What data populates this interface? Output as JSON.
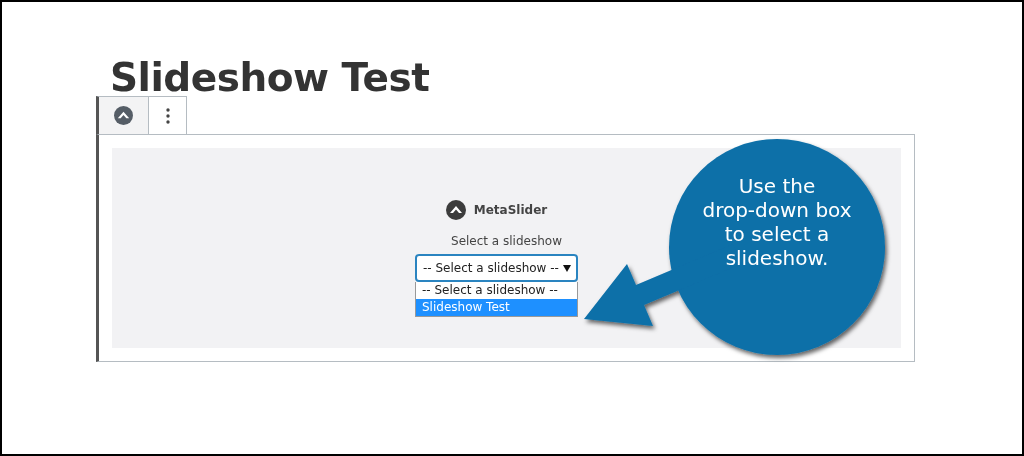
{
  "page": {
    "title": "Slideshow Test"
  },
  "block": {
    "plugin_name": "MetaSlider",
    "label": "Select a slideshow",
    "select": {
      "value": "-- Select a slideshow --",
      "expanded": true
    },
    "options": [
      {
        "label": "-- Select a slideshow --",
        "selected": false
      },
      {
        "label": "Slideshow Test",
        "selected": true
      }
    ]
  },
  "callout": {
    "lines": [
      "Use the",
      "drop-down box",
      "to select a",
      "slideshow."
    ]
  }
}
